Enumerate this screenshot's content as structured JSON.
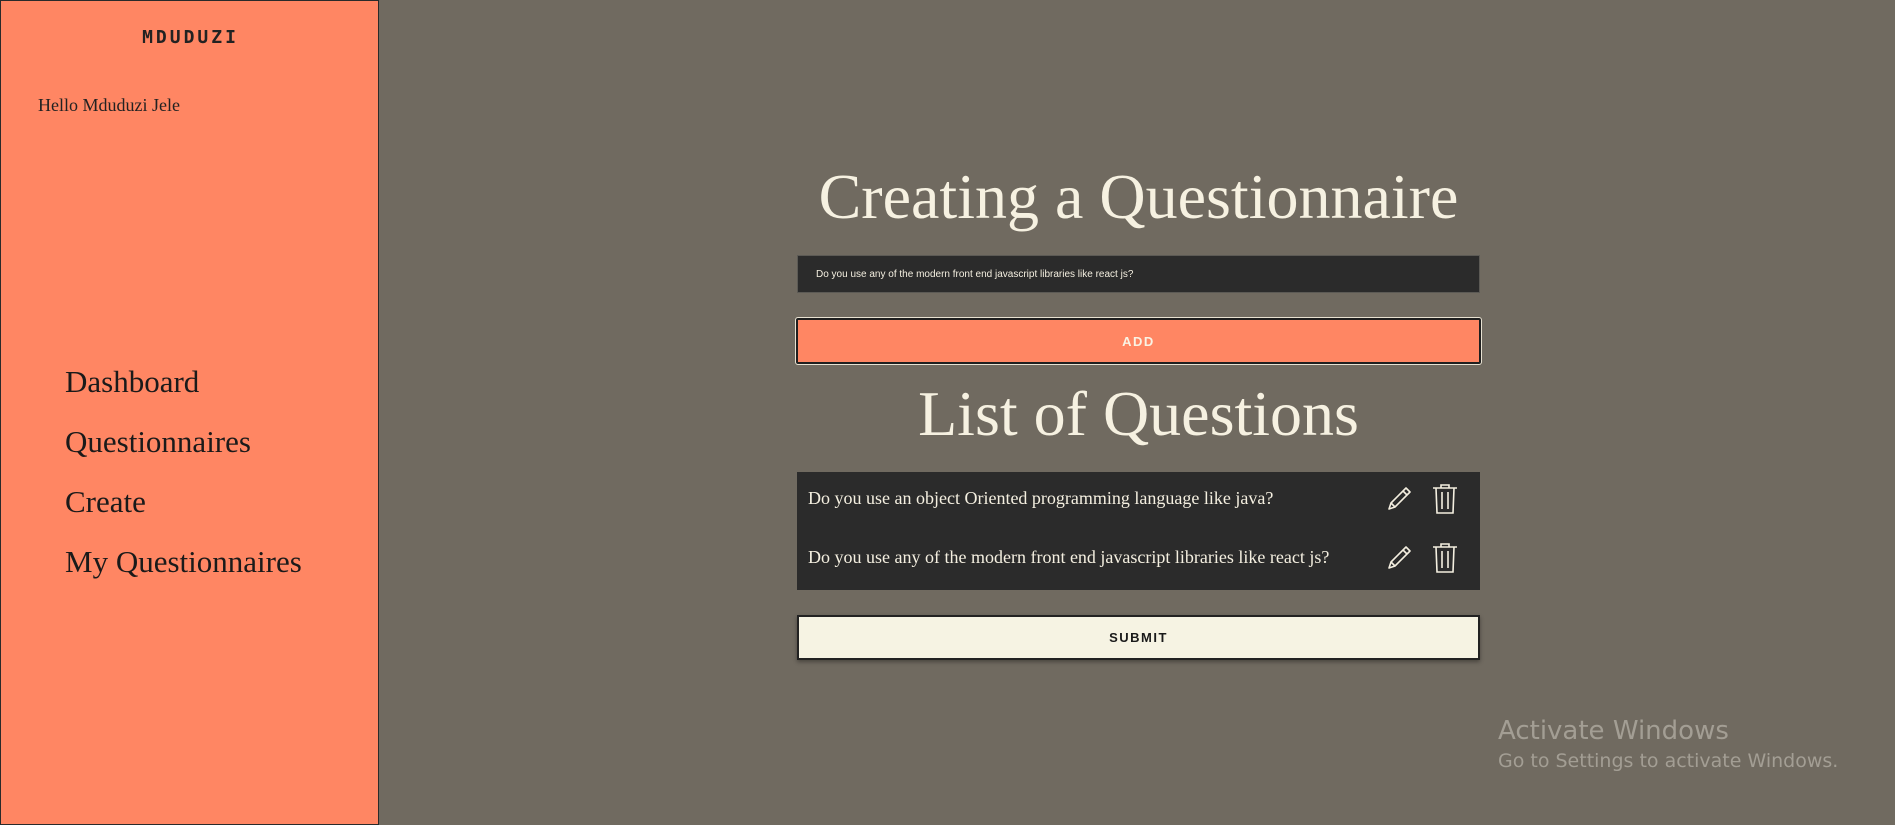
{
  "sidebar": {
    "logo": "MDUDUZI",
    "greeting": "Hello Mduduzi Jele",
    "nav": [
      "Dashboard",
      "Questionnaires",
      "Create",
      "My Questionnaires"
    ]
  },
  "main": {
    "title": "Creating a Questionnaire",
    "input_value": "Do you use any of the modern front end javascript libraries like react js?",
    "add_label": "ADD",
    "list_title": "List of Questions",
    "questions": [
      "Do you use an object Oriented programming language like java?",
      "Do you use any of the modern front end javascript libraries like react js?"
    ],
    "submit_label": "SUBMIT"
  },
  "watermark": {
    "title": "Activate Windows",
    "subtitle": "Go to Settings to activate Windows."
  },
  "colors": {
    "background": "#706a60",
    "sidebar": "#ff8663",
    "accent": "#ff8663",
    "dark_panel": "#2b2b2b",
    "cream": "#f6f1e1"
  },
  "icons": {
    "edit": "pencil-icon",
    "delete": "trash-icon"
  }
}
